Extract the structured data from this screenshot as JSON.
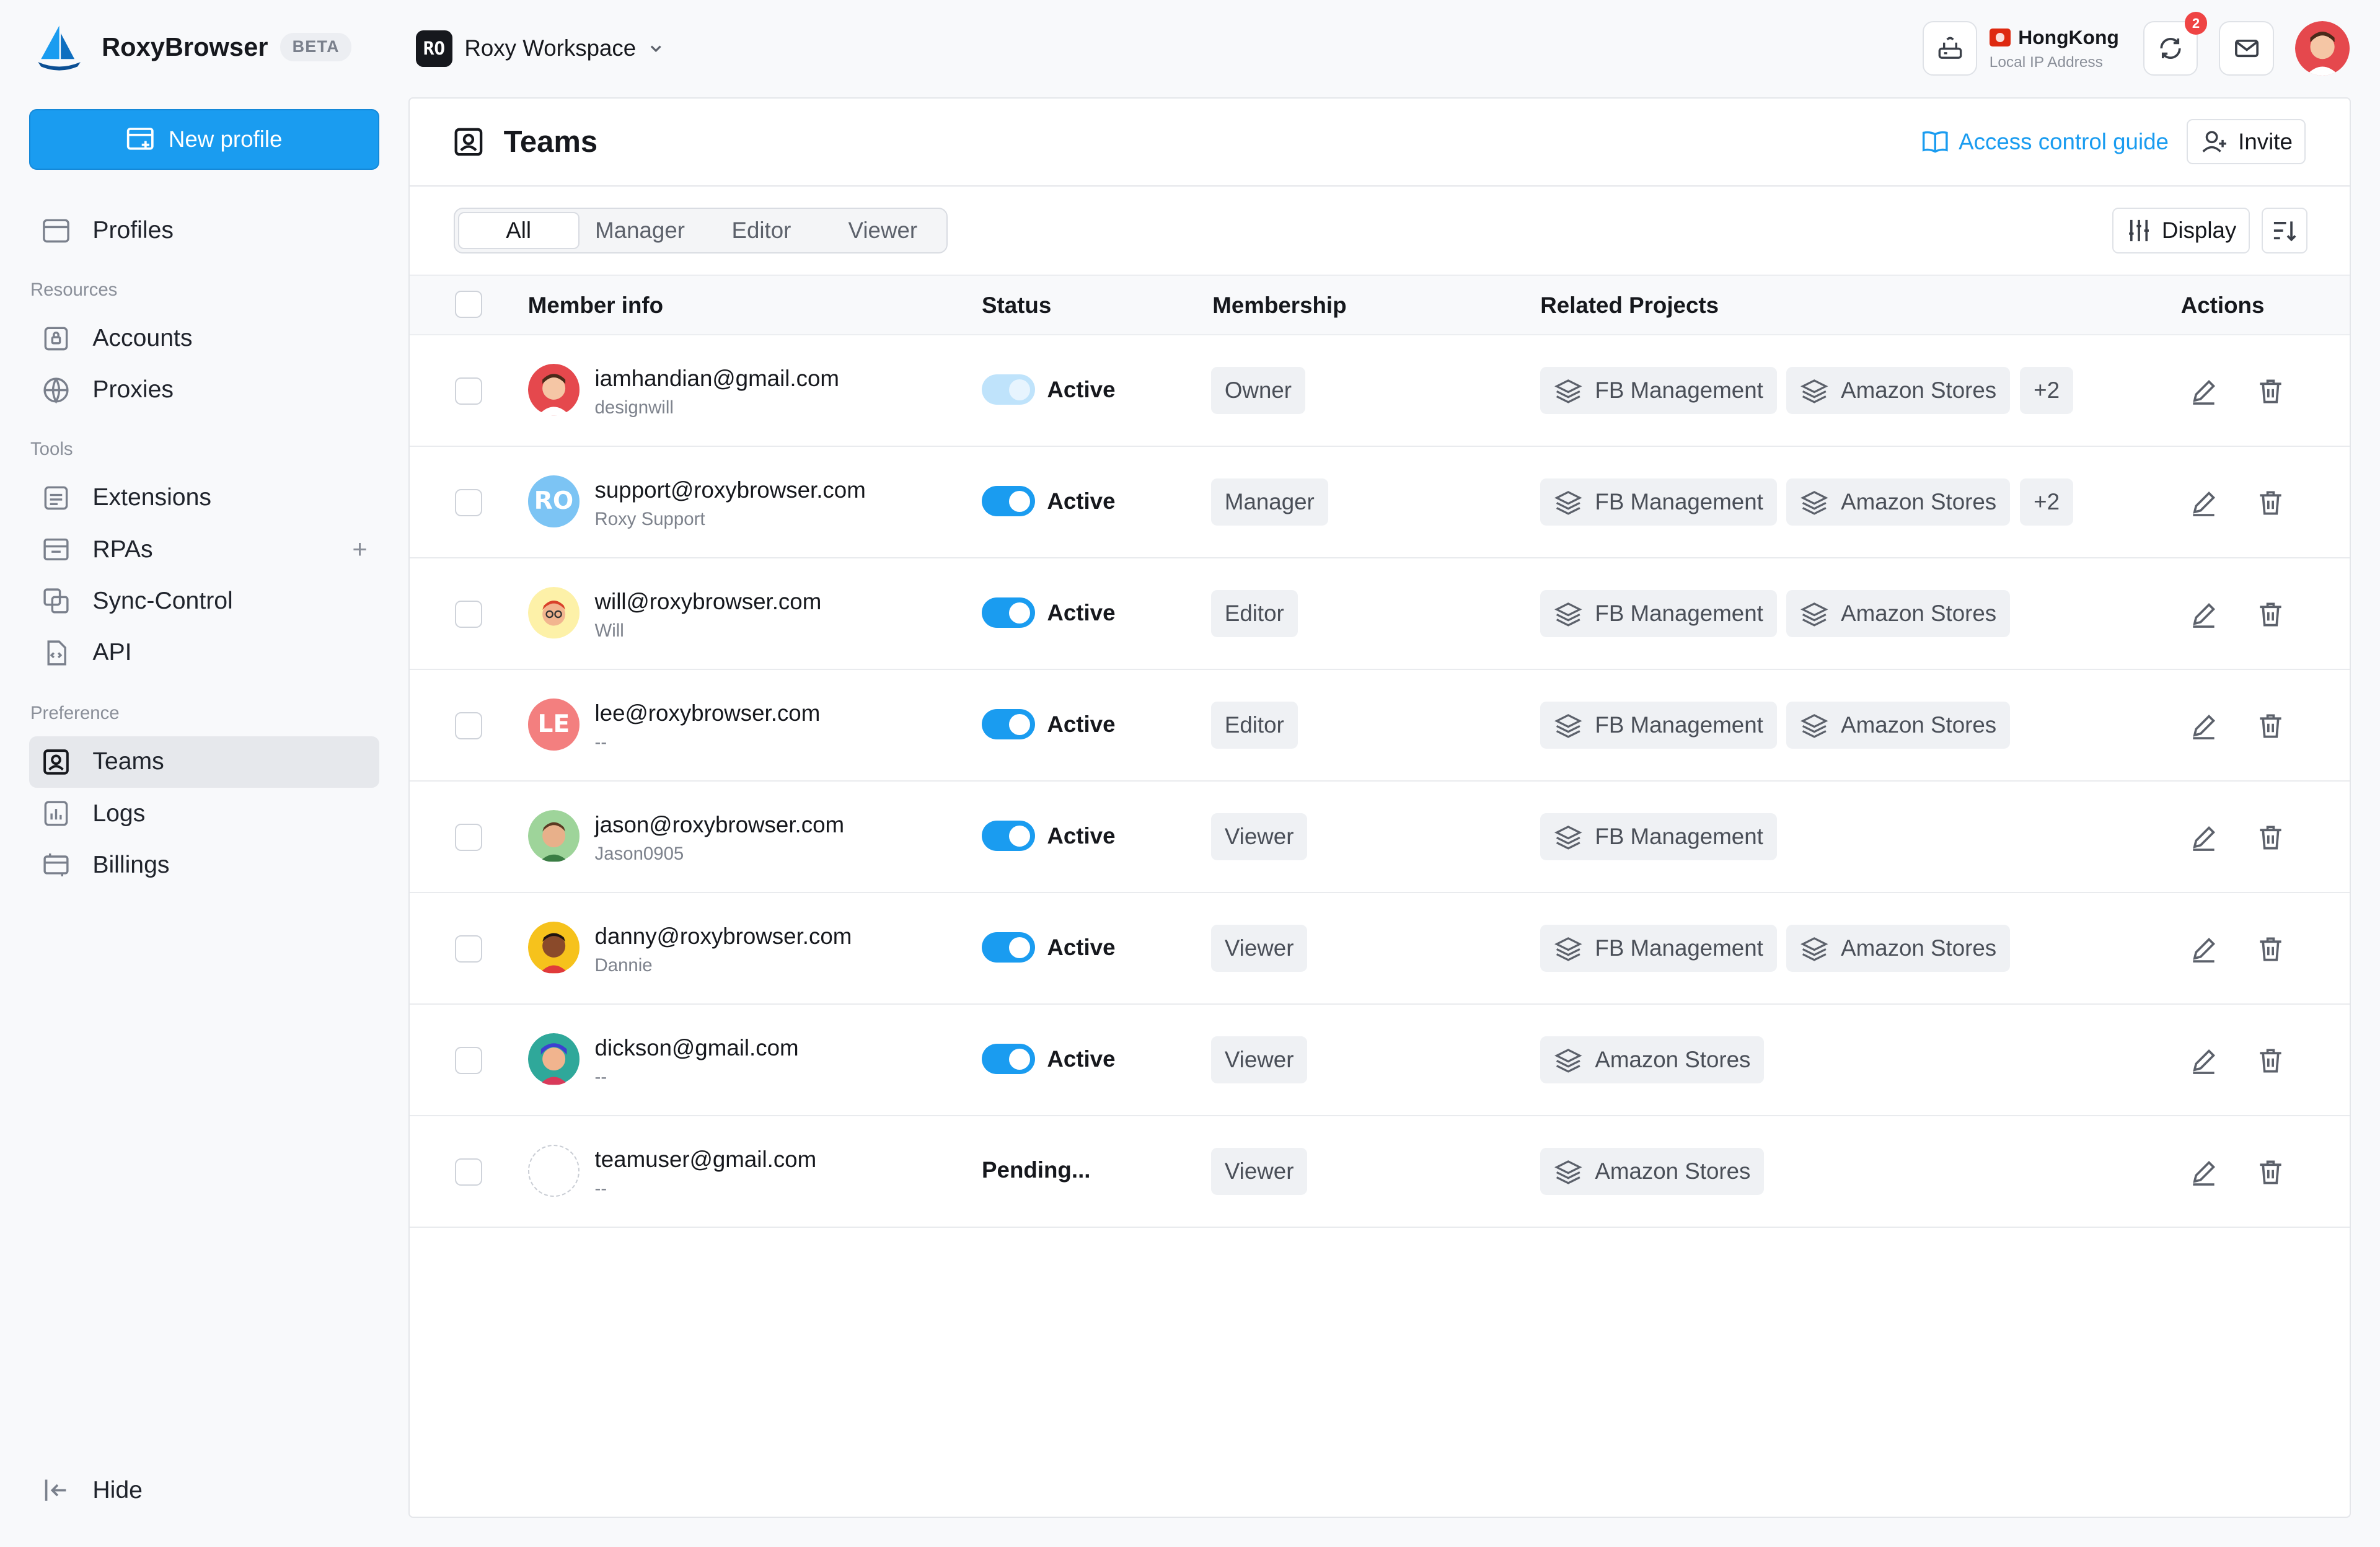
{
  "app": {
    "name": "RoxyBrowser",
    "badge": "BETA"
  },
  "workspace": {
    "initials": "RO",
    "name": "Roxy Workspace"
  },
  "ip": {
    "location": "HongKong",
    "label": "Local IP Address"
  },
  "notifications": {
    "count": "2"
  },
  "sidebar": {
    "new_profile": "New profile",
    "profiles": "Profiles",
    "section_resources": "Resources",
    "accounts": "Accounts",
    "proxies": "Proxies",
    "section_tools": "Tools",
    "extensions": "Extensions",
    "rpas": "RPAs",
    "sync_control": "Sync-Control",
    "api": "API",
    "section_preference": "Preference",
    "teams": "Teams",
    "logs": "Logs",
    "billings": "Billings",
    "hide": "Hide"
  },
  "page": {
    "title": "Teams",
    "guide": "Access control guide",
    "invite": "Invite",
    "display": "Display",
    "tabs": [
      "All",
      "Manager",
      "Editor",
      "Viewer"
    ]
  },
  "table": {
    "headers": {
      "member": "Member info",
      "status": "Status",
      "membership": "Membership",
      "projects": "Related Projects",
      "actions": "Actions"
    },
    "rows": [
      {
        "email": "iamhandian@gmail.com",
        "sub": "designwill",
        "status": "Active",
        "role": "Owner",
        "projects": [
          "FB Management",
          "Amazon Stores"
        ],
        "more": "+2"
      },
      {
        "email": "support@roxybrowser.com",
        "sub": "Roxy Support",
        "initials": "RO",
        "status": "Active",
        "role": "Manager",
        "projects": [
          "FB Management",
          "Amazon Stores"
        ],
        "more": "+2"
      },
      {
        "email": "will@roxybrowser.com",
        "sub": "Will",
        "status": "Active",
        "role": "Editor",
        "projects": [
          "FB Management",
          "Amazon Stores"
        ]
      },
      {
        "email": "lee@roxybrowser.com",
        "sub": "--",
        "initials": "LE",
        "status": "Active",
        "role": "Editor",
        "projects": [
          "FB Management",
          "Amazon Stores"
        ]
      },
      {
        "email": "jason@roxybrowser.com",
        "sub": "Jason0905",
        "status": "Active",
        "role": "Viewer",
        "projects": [
          "FB Management"
        ]
      },
      {
        "email": "danny@roxybrowser.com",
        "sub": "Dannie",
        "status": "Active",
        "role": "Viewer",
        "projects": [
          "FB Management",
          "Amazon Stores"
        ]
      },
      {
        "email": "dickson@gmail.com",
        "sub": "--",
        "status": "Active",
        "role": "Viewer",
        "projects": [
          "Amazon Stores"
        ]
      },
      {
        "email": "teamuser@gmail.com",
        "sub": "--",
        "status": "Pending...",
        "role": "Viewer",
        "projects": [
          "Amazon Stores"
        ]
      }
    ]
  },
  "colors": {
    "accent": "#1a9cf0",
    "sidebar_active": "#e6e8ec",
    "tag_bg": "#eff1f4"
  }
}
